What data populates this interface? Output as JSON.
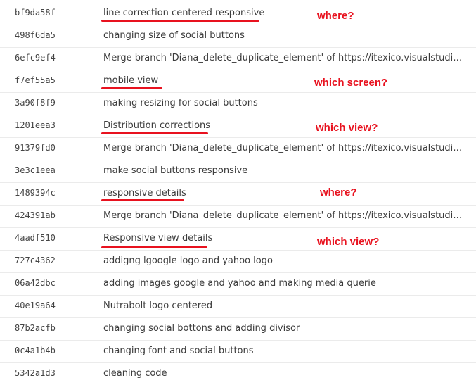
{
  "commits": [
    {
      "id": "bf9da58f",
      "message": "line correction centered responsive"
    },
    {
      "id": "498f6da5",
      "message": "changing size of social buttons"
    },
    {
      "id": "6efc9ef4",
      "message": "Merge branch 'Diana_delete_duplicate_element' of https://itexico.visualstudio.com..."
    },
    {
      "id": "f7ef55a5",
      "message": "mobile view"
    },
    {
      "id": "3a90f8f9",
      "message": "making resizing for social buttons"
    },
    {
      "id": "1201eea3",
      "message": "Distribution corrections"
    },
    {
      "id": "91379fd0",
      "message": "Merge branch 'Diana_delete_duplicate_element' of https://itexico.visualstudio.com..."
    },
    {
      "id": "3e3c1eea",
      "message": "make social buttons responsive"
    },
    {
      "id": "1489394c",
      "message": "responsive details"
    },
    {
      "id": "424391ab",
      "message": "Merge branch 'Diana_delete_duplicate_element' of https://itexico.visualstudio.com..."
    },
    {
      "id": "4aadf510",
      "message": "Responsive view details"
    },
    {
      "id": "727c4362",
      "message": "addigng lgoogle logo and yahoo logo"
    },
    {
      "id": "06a42dbc",
      "message": "adding images google and yahoo and making media querie"
    },
    {
      "id": "40e19a64",
      "message": "Nutrabolt logo centered"
    },
    {
      "id": "87b2acfb",
      "message": "changing social bottons and adding divisor"
    },
    {
      "id": "0c4a1b4b",
      "message": "changing font and social buttons"
    },
    {
      "id": "5342a1d3",
      "message": "cleaning code"
    }
  ],
  "annotations": [
    {
      "text": "where?"
    },
    {
      "text": "which screen?"
    },
    {
      "text": "which view?"
    },
    {
      "text": "where?"
    },
    {
      "text": "which view?"
    }
  ],
  "colors": {
    "annotation": "#e8121f",
    "row_divider": "#ebebeb",
    "text": "#3b3b3b"
  }
}
